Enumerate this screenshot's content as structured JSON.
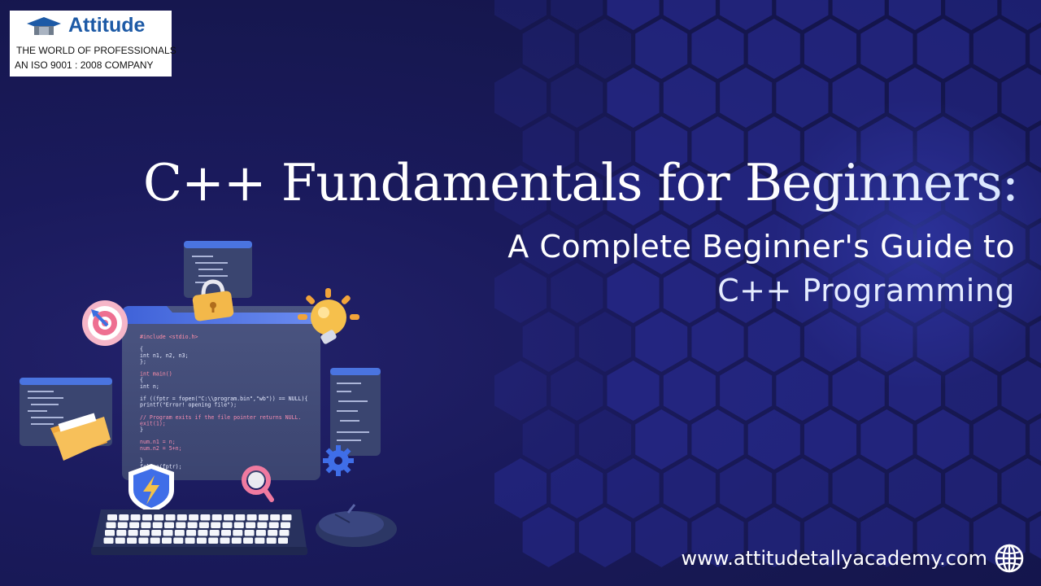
{
  "logo": {
    "name": "Attitude",
    "tagline": "THE WORLD OF PROFESSIONALS",
    "certification": "AN ISO 9001 : 2008 COMPANY"
  },
  "headline": {
    "title": "C++ Fundamentals for Beginners:",
    "subtitle_line1": "A Complete Beginner's Guide to",
    "subtitle_line2": "C++ Programming"
  },
  "footer": {
    "website": "www.attitudetallyacademy.com",
    "icon": "globe-icon"
  },
  "illustration": {
    "main_code": [
      "#include <stdio.h>",
      "",
      "{",
      "   int n1, n2, n3;",
      "};",
      "",
      "int main()",
      "{",
      "   int n;",
      "",
      "   if ((fptr = fopen(\"C:\\\\program.bin\",\"wb\")) == NULL){",
      "       printf(\"Error! opening file\");",
      "",
      "       // Program exits if the file pointer returns NULL.",
      "       exit(1);",
      "   }",
      "",
      "       num.n1 = n;",
      "       num.n2 = 5+n;",
      "",
      "   }",
      "   fclose(fptr);"
    ],
    "icons": [
      "lock-icon",
      "target-icon",
      "lightbulb-icon",
      "folder-icon",
      "shield-icon",
      "magnifier-icon",
      "gear-icon",
      "keyboard-icon",
      "mouse-icon"
    ]
  },
  "colors": {
    "background": "#1a1a5c",
    "hexagon": "#2b2f9e",
    "brand_blue": "#1d5aa6",
    "text": "#ffffff"
  }
}
